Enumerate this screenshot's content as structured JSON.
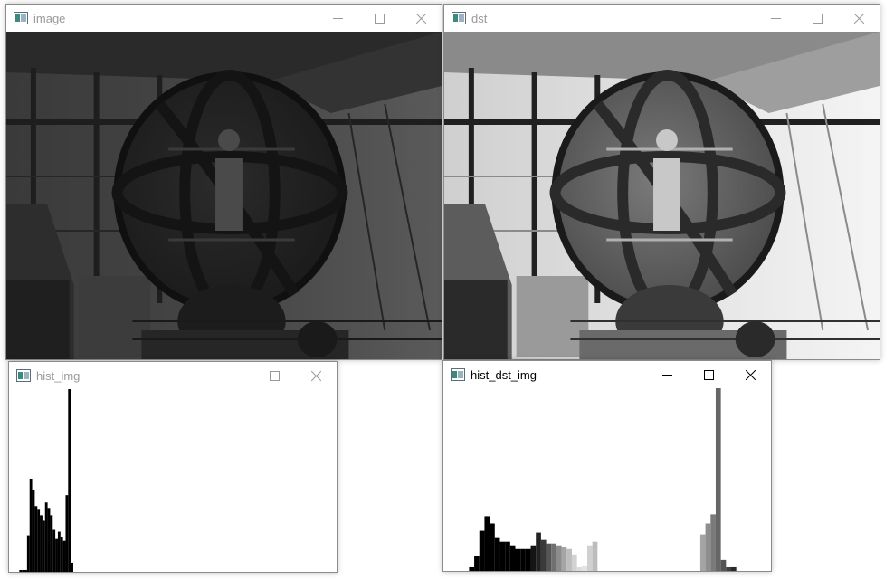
{
  "windows": {
    "image": {
      "title": "image",
      "active": false,
      "brightness": "dark"
    },
    "dst": {
      "title": "dst",
      "active": false,
      "brightness": "equalized"
    },
    "hist_img": {
      "title": "hist_img",
      "active": false
    },
    "hist_dst_img": {
      "title": "hist_dst_img",
      "active": true
    }
  },
  "colors": {
    "titlebar_bg": "#ffffff",
    "inactive_text": "#9a9a9a",
    "active_text": "#000000",
    "window_border": "#8a8a8a"
  },
  "icons": {
    "app": "opencv-window-icon",
    "minimize": "minimize-icon",
    "maximize": "maximize-icon",
    "close": "close-icon"
  },
  "chart_data": [
    {
      "type": "bar",
      "window": "hist_img",
      "x": [
        8,
        10,
        12,
        14,
        16,
        18,
        20,
        22,
        24,
        26,
        28,
        30,
        32,
        34,
        36,
        38,
        40,
        42,
        44,
        46,
        48,
        50
      ],
      "values": [
        0.01,
        0.01,
        0.01,
        0.2,
        0.51,
        0.45,
        0.36,
        0.34,
        0.31,
        0.28,
        0.38,
        0.35,
        0.31,
        0.23,
        0.18,
        0.22,
        0.19,
        0.17,
        0.42,
        1.0,
        0.05,
        0.0
      ],
      "colors": [
        "#000000"
      ],
      "xlim": [
        0,
        255
      ],
      "ylim": [
        0,
        1
      ],
      "grid": false
    },
    {
      "type": "bar",
      "window": "hist_dst_img",
      "x": [
        20,
        24,
        28,
        32,
        36,
        40,
        44,
        48,
        52,
        56,
        60,
        64,
        68,
        72,
        76,
        80,
        84,
        88,
        92,
        96,
        100,
        104,
        108,
        112,
        116,
        200,
        204,
        208,
        212,
        216,
        220,
        224
      ],
      "values": [
        0.02,
        0.08,
        0.22,
        0.3,
        0.26,
        0.18,
        0.16,
        0.16,
        0.14,
        0.12,
        0.12,
        0.12,
        0.14,
        0.21,
        0.17,
        0.15,
        0.15,
        0.14,
        0.13,
        0.12,
        0.09,
        0.02,
        0.03,
        0.14,
        0.16,
        0.2,
        0.26,
        0.31,
        1.0,
        0.06,
        0.02,
        0.02
      ],
      "colors": [
        "#000000",
        "#000000",
        "#000000",
        "#000000",
        "#000000",
        "#000000",
        "#000000",
        "#000000",
        "#000000",
        "#000000",
        "#000000",
        "#000000",
        "#141414",
        "#222222",
        "#3a3a3a",
        "#555555",
        "#707070",
        "#8c8c8c",
        "#a5a5a5",
        "#bdbdbd",
        "#d2d2d2",
        "#dcdcdc",
        "#e2e2e2",
        "#d0d0d0",
        "#bcbcbc",
        "#a4a4a4",
        "#8e8e8e",
        "#7a7a7a",
        "#666666",
        "#555555",
        "#404040",
        "#2a2a2a"
      ],
      "xlim": [
        0,
        255
      ],
      "ylim": [
        0,
        1
      ],
      "grid": false
    }
  ]
}
